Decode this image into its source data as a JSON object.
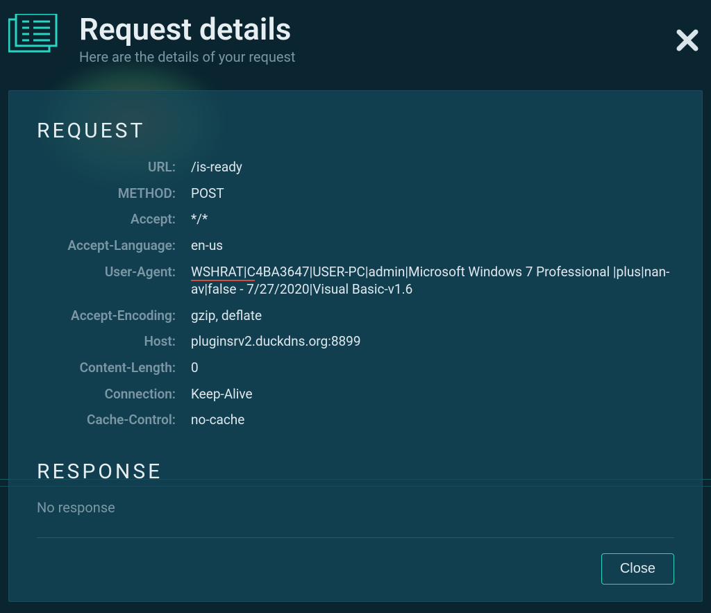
{
  "header": {
    "title": "Request details",
    "subtitle": "Here are the details of your request"
  },
  "sections": {
    "request_title": "REQUEST",
    "response_title": "RESPONSE",
    "no_response": "No response"
  },
  "request": {
    "url_label": "URL:",
    "url": "/is-ready",
    "method_label": "METHOD:",
    "method": "POST",
    "accept_label": "Accept:",
    "accept": "*/*",
    "accept_language_label": "Accept-Language:",
    "accept_language": "en-us",
    "user_agent_label": "User-Agent:",
    "user_agent": "WSHRAT|C4BA3647|USER-PC|admin|Microsoft Windows 7 Professional |plus|nan-av|false - 7/27/2020|Visual Basic-v1.6",
    "accept_encoding_label": "Accept-Encoding:",
    "accept_encoding": "gzip, deflate",
    "host_label": "Host:",
    "host": "pluginsrv2.duckdns.org:8899",
    "content_length_label": "Content-Length:",
    "content_length": "0",
    "connection_label": "Connection:",
    "connection": "Keep-Alive",
    "cache_control_label": "Cache-Control:",
    "cache_control": "no-cache"
  },
  "buttons": {
    "close": "Close"
  }
}
